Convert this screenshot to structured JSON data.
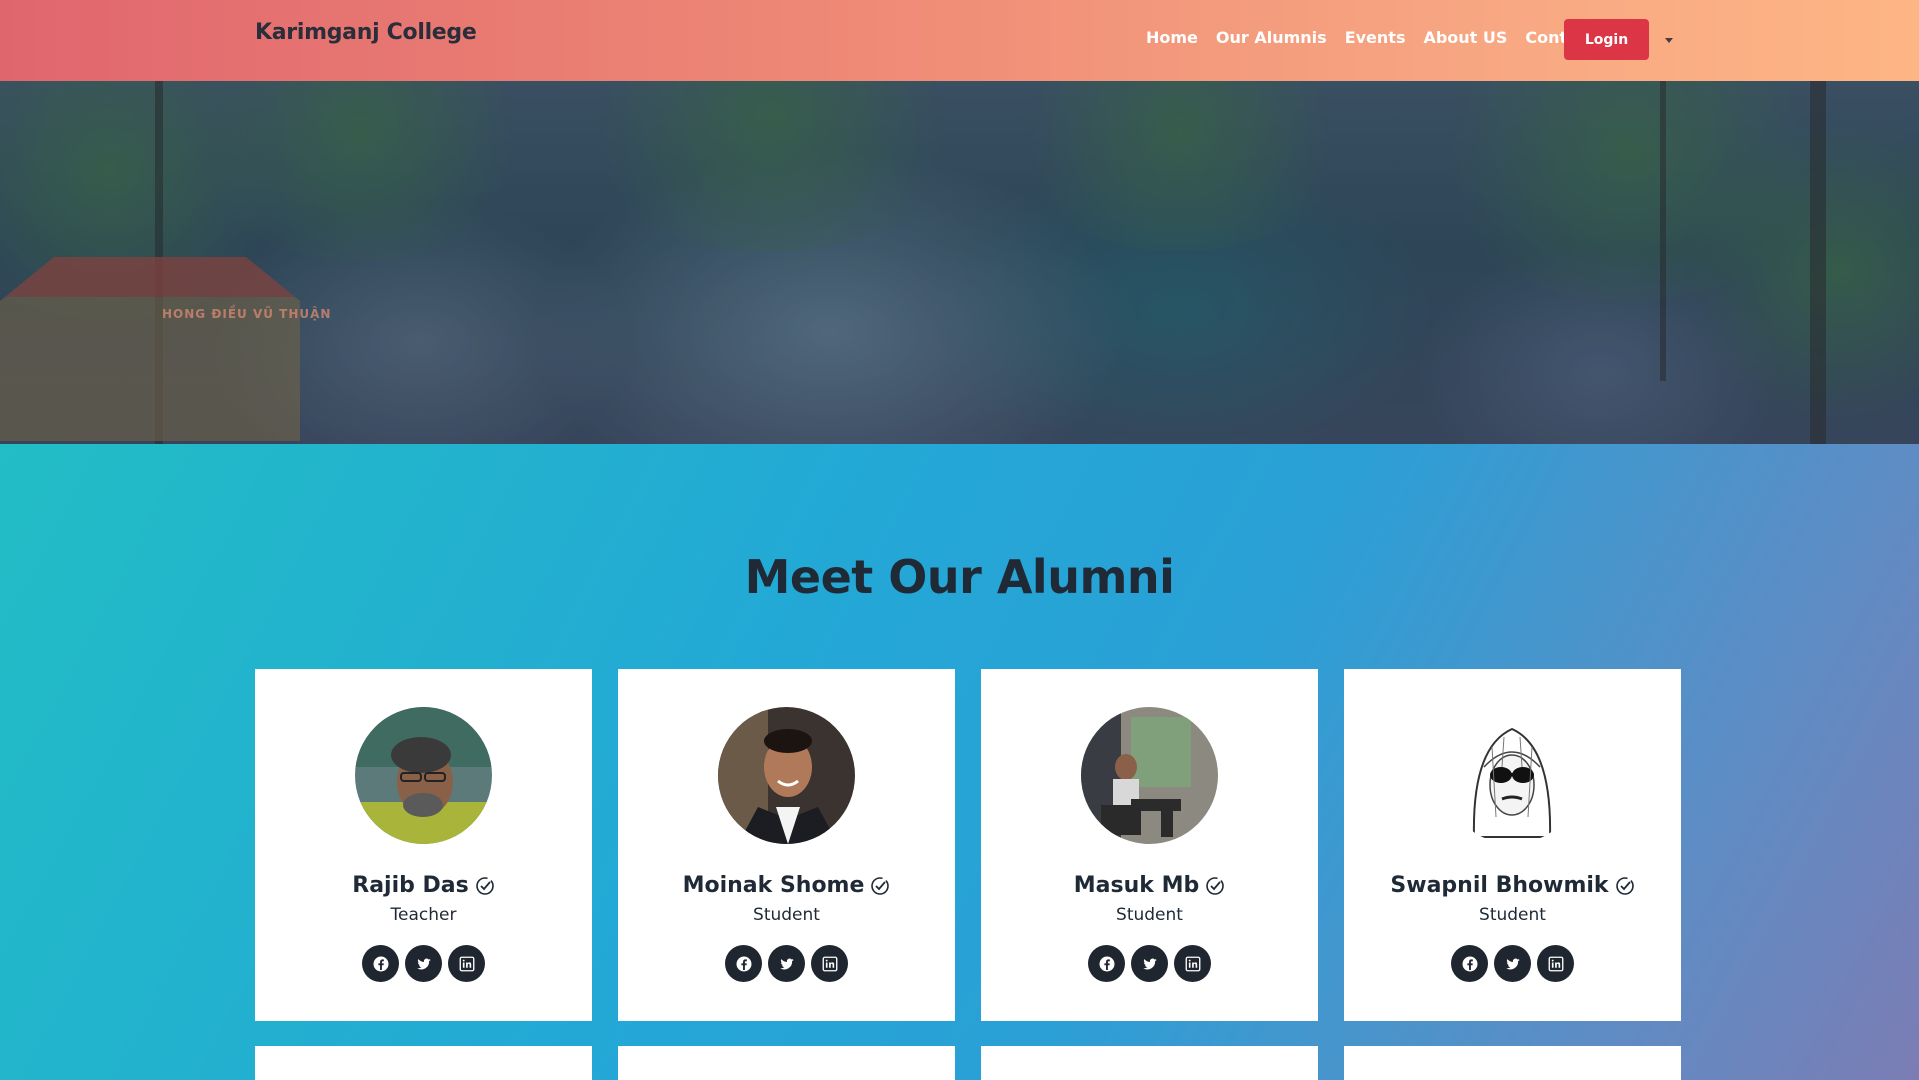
{
  "navbar": {
    "brand": "Karimganj College",
    "links": [
      "Home",
      "Our Alumnis",
      "Events",
      "About US",
      "Contact"
    ],
    "login_label": "Login",
    "dropdown_icon": "caret-down-icon"
  },
  "hero": {
    "gate_text": "HONG ĐIỀU VŨ THUẬN"
  },
  "section": {
    "title": "Meet Our Alumni"
  },
  "alumni": [
    {
      "name": "Rajib Das",
      "role": "Teacher",
      "avatar": "photo-man-glasses-green-shirt"
    },
    {
      "name": "Moinak Shome",
      "role": "Student",
      "avatar": "photo-man-suit-smiling"
    },
    {
      "name": "Masuk Mb",
      "role": "Student",
      "avatar": "photo-man-sitting-chair"
    },
    {
      "name": "Swapnil Bhowmik",
      "role": "Student",
      "avatar": "sketch-hooded-man-sunglasses"
    }
  ],
  "social_icons": [
    "facebook-icon",
    "twitter-icon",
    "linkedin-icon"
  ],
  "colors": {
    "navbar_gradient_start": "#e0666e",
    "navbar_gradient_end": "#feb584",
    "login_button": "#dc3545",
    "section_gradient_start": "#22bdc5",
    "section_gradient_end": "#7b7db4",
    "title_text": "#1f2a36",
    "social_bg": "#1f2630"
  }
}
